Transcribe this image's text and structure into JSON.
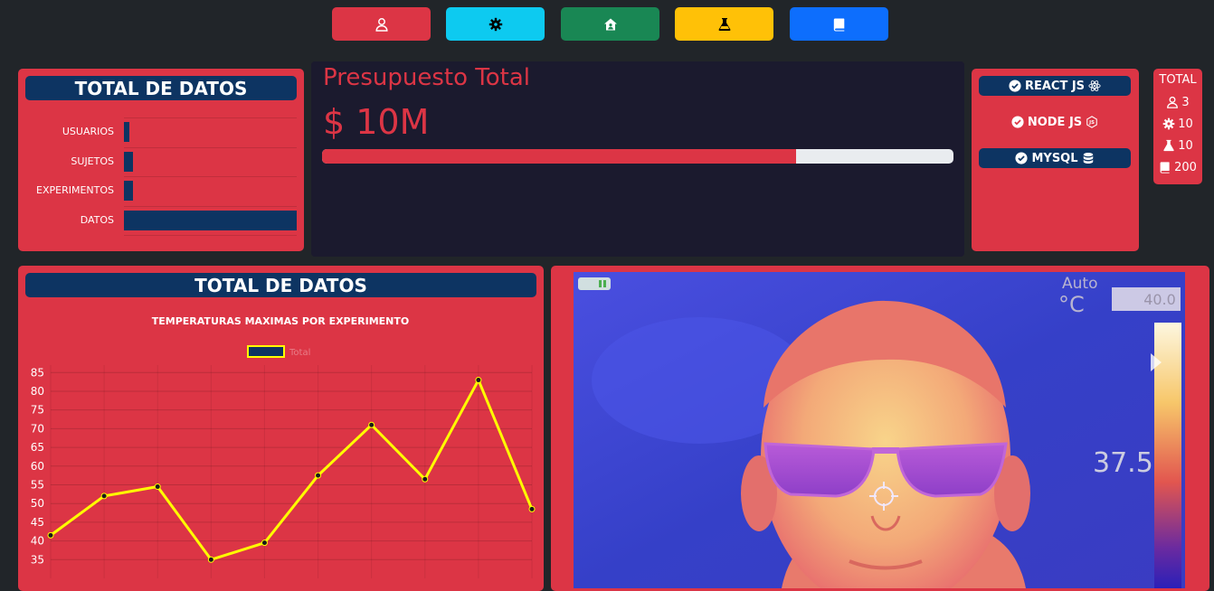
{
  "nav": {
    "buttons": [
      {
        "icon": "user-icon",
        "color": "#dc3545"
      },
      {
        "icon": "gear-icon",
        "color": "#0dcaf0"
      },
      {
        "icon": "house-user-icon",
        "color": "#198754"
      },
      {
        "icon": "flask-icon",
        "color": "#ffc107"
      },
      {
        "icon": "book-icon",
        "color": "#0d6efd"
      }
    ]
  },
  "totals_card": {
    "title": "TOTAL DE DATOS",
    "bars": [
      {
        "label": "USUARIOS",
        "value": 3
      },
      {
        "label": "SUJETOS",
        "value": 10
      },
      {
        "label": "EXPERIMENTOS",
        "value": 10
      },
      {
        "label": "DATOS",
        "value": 200
      }
    ]
  },
  "budget": {
    "title": "Presupuesto Total",
    "amount": "$ 10M",
    "progress": 0.75
  },
  "tech": {
    "items": [
      {
        "label": "REACT JS",
        "icon": "react-icon",
        "style": "pill"
      },
      {
        "label": "NODE JS",
        "icon": "nodejs-icon",
        "style": "plain"
      },
      {
        "label": "MYSQL",
        "icon": "database-icon",
        "style": "pill"
      }
    ]
  },
  "summary": {
    "title": "TOTAL",
    "rows": [
      {
        "icon": "user-icon",
        "value": "3"
      },
      {
        "icon": "gear-icon",
        "value": "10"
      },
      {
        "icon": "flask-icon",
        "value": "10"
      },
      {
        "icon": "book-icon",
        "value": "200"
      }
    ]
  },
  "chart_card": {
    "title": "TOTAL DE DATOS"
  },
  "chart_data": {
    "type": "line",
    "title": "TEMPERATURAS MAXIMAS POR EXPERIMENTO",
    "series": [
      {
        "name": "Total",
        "values": [
          41.5,
          52,
          54.5,
          35,
          39.5,
          57.5,
          71,
          56.5,
          83,
          48.5
        ],
        "color": "#ffff00"
      }
    ],
    "y_ticks": [
      35,
      40,
      45,
      50,
      55,
      60,
      65,
      70,
      75,
      80,
      85
    ],
    "ylim": [
      30,
      87
    ],
    "grid": true,
    "legend": "top-center"
  },
  "thermal": {
    "mode_label": "Auto",
    "unit_label": "°C",
    "max_reading": "40.0",
    "temperature": "37.5"
  }
}
